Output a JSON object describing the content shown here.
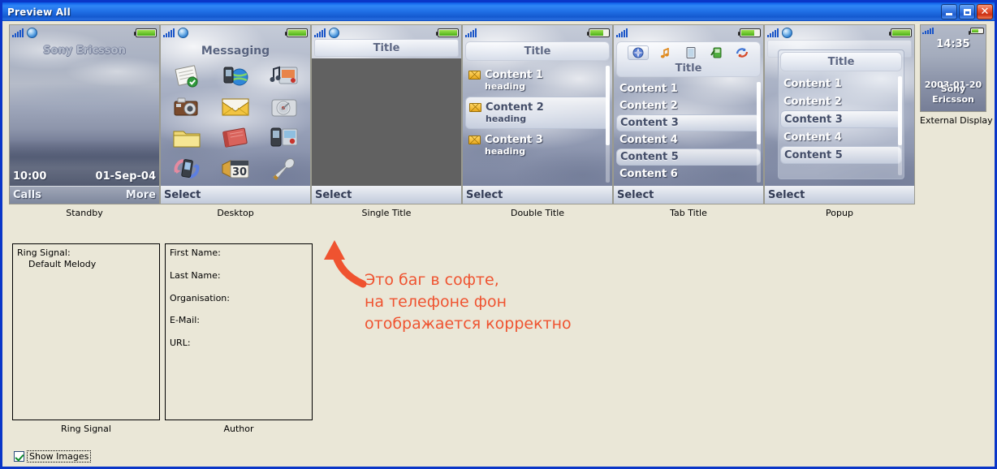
{
  "window": {
    "title": "Preview All",
    "minimize_label": "Minimize",
    "maximize_label": "Maximize",
    "close_label": "Close",
    "background_color": "#eae7d7",
    "titlebar_color": "#1f6ee4"
  },
  "previews": [
    {
      "caption": "Standby",
      "kind": "standby",
      "brand": "Sony Ericsson",
      "time": "10:00",
      "date": "01-Sep-04",
      "softkey_left": "Calls",
      "softkey_right": "More"
    },
    {
      "caption": "Desktop",
      "kind": "desktop",
      "title": "Messaging",
      "softkey_left": "Select",
      "icons": [
        "notes-icon",
        "web-phone-icon",
        "multimedia-icon",
        "camera-icon",
        "envelope-icon",
        "music-player-icon",
        "folder-icon",
        "organizer-book-icon",
        "phone-image-icon",
        "sync-phone-icon",
        "calendar-30-icon",
        "settings-wrench-icon"
      ]
    },
    {
      "caption": "Single Title",
      "kind": "single",
      "title": "Title",
      "softkey_left": "Select",
      "body_color": "#616161"
    },
    {
      "caption": "Double Title",
      "kind": "double",
      "title": "Title",
      "softkey_left": "Select",
      "rows": [
        {
          "label": "Content 1",
          "sub": "heading",
          "selected": false
        },
        {
          "label": "Content 2",
          "sub": "heading",
          "selected": true
        },
        {
          "label": "Content 3",
          "sub": "heading",
          "selected": false
        }
      ]
    },
    {
      "caption": "Tab Title",
      "kind": "tab",
      "title": "Title",
      "softkey_left": "Select",
      "tabs": [
        "compass-icon",
        "music-note-icon",
        "book-icon",
        "green-phone-icon",
        "sync-arrows-icon"
      ],
      "rows": [
        {
          "label": "Content 1",
          "selected": false
        },
        {
          "label": "Content 2",
          "selected": false
        },
        {
          "label": "Content 3",
          "selected": true
        },
        {
          "label": "Content 4",
          "selected": false
        },
        {
          "label": "Content 5",
          "selected": true
        },
        {
          "label": "Content 6",
          "selected": false
        }
      ]
    },
    {
      "caption": "Popup",
      "kind": "popup",
      "title": "Title",
      "softkey_left": "Select",
      "rows": [
        {
          "label": "Content 1",
          "selected": false
        },
        {
          "label": "Content 2",
          "selected": false
        },
        {
          "label": "Content 3",
          "selected": true
        },
        {
          "label": "Content 4",
          "selected": false
        },
        {
          "label": "Content 5",
          "selected": true
        }
      ]
    }
  ],
  "external_display": {
    "caption": "External Display",
    "time": "14:35",
    "date": "2003-01-20",
    "brand": "Sony Ericsson"
  },
  "ring_signal": {
    "caption": "Ring Signal",
    "label": "Ring Signal:",
    "value": "Default Melody"
  },
  "author": {
    "caption": "Author",
    "fields": [
      "First Name:",
      "Last Name:",
      "Organisation:",
      "E-Mail:",
      "URL:"
    ]
  },
  "annotation": {
    "color": "#ef5330",
    "line1": "Это баг в софте,",
    "line2": "на телефоне фон",
    "line3": "отображается корректно"
  },
  "show_images": {
    "label": "Show Images",
    "checked": true
  }
}
